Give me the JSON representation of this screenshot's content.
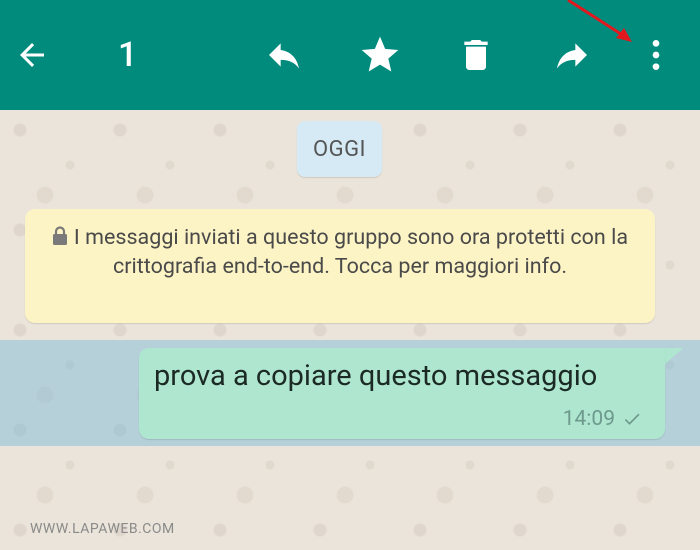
{
  "toolbar": {
    "selected_count": "1",
    "color": "#008b7d",
    "icons": [
      "back-arrow-icon",
      "reply-icon",
      "star-icon",
      "delete-icon",
      "forward-icon",
      "more-options-icon"
    ]
  },
  "chat": {
    "date_chip": "OGGI",
    "encryption_notice": "I messaggi inviati a questo gruppo sono ora protetti con la crittografia end-to-end. Tocca per maggiori info.",
    "message": {
      "text": "prova a copiare questo messaggio",
      "time": "14:09",
      "status": "sent-check"
    }
  },
  "watermark": "WWW.LAPAWEB.COM"
}
